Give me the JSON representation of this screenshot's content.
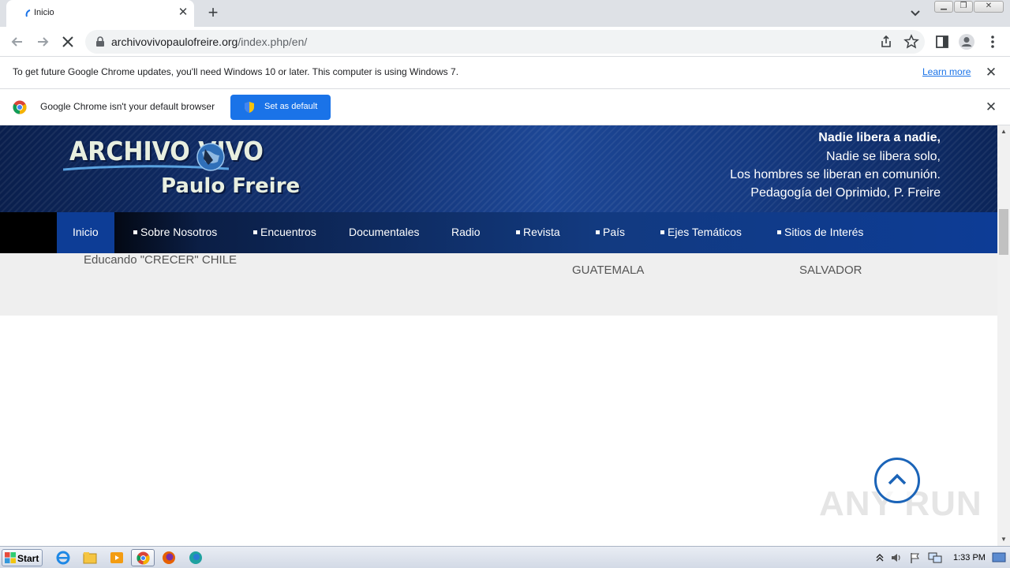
{
  "browser": {
    "tab": {
      "title": "Inicio"
    },
    "omnibox": {
      "url_domain": "archivovivopaulofreire.org",
      "url_path": "/index.php/en/"
    },
    "infobar_update": {
      "message": "To get future Google Chrome updates, you'll need Windows 10 or later. This computer is using Windows 7.",
      "link": "Learn more"
    },
    "infobar_default": {
      "message": "Google Chrome isn't your default browser",
      "button": "Set as default"
    }
  },
  "site": {
    "logo": {
      "line1": "ARCHIVO VIVO",
      "line2": "Paulo Freire"
    },
    "quote": [
      "Nadie libera a nadie,",
      "Nadie se libera solo,",
      "Los hombres se liberan en comunión.",
      "Pedagogía del Oprimido,  P. Freire"
    ],
    "nav": [
      {
        "label": "Inicio",
        "bullet": false
      },
      {
        "label": "Sobre Nosotros",
        "bullet": true
      },
      {
        "label": "Encuentros",
        "bullet": true
      },
      {
        "label": "Documentales",
        "bullet": false
      },
      {
        "label": "Radio",
        "bullet": false
      },
      {
        "label": "Revista",
        "bullet": true
      },
      {
        "label": "País",
        "bullet": true
      },
      {
        "label": "Ejes Temáticos",
        "bullet": true
      },
      {
        "label": "Sitios de Interés",
        "bullet": true
      }
    ],
    "content": {
      "item1": "Educando \"CRECER\" CHILE",
      "item2": "GUATEMALA",
      "item3": "SALVADOR"
    },
    "watermark": "ANY RUN"
  },
  "taskbar": {
    "start": "Start",
    "clock": "1:33 PM"
  },
  "colors": {
    "accent": "#1a73e8",
    "nav_active": "#0d3d96",
    "header_dark": "#0a1f4d"
  }
}
